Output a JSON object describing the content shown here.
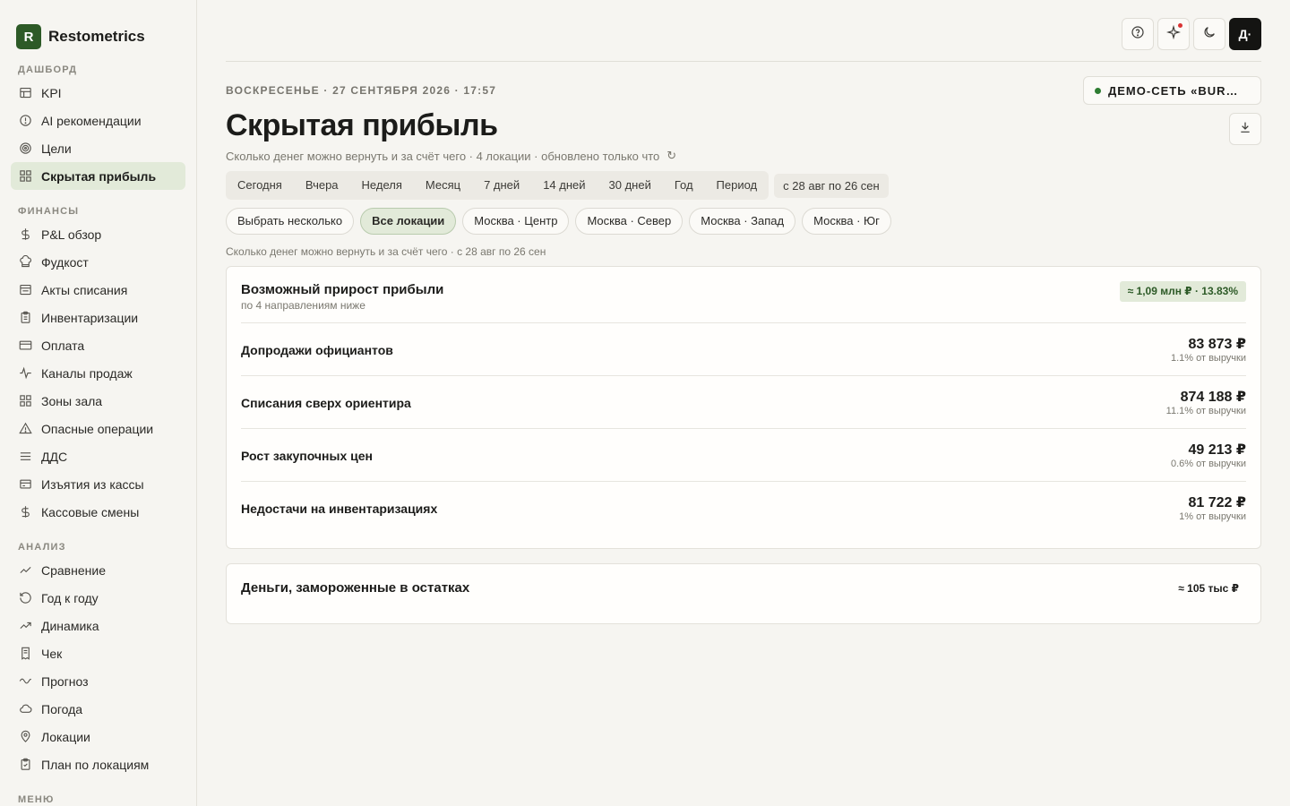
{
  "brand": {
    "logo_letter": "R",
    "name": "Restometrics"
  },
  "sidebar": {
    "sections": [
      {
        "label": "ДАШБОРД",
        "items": [
          {
            "label": "KPI",
            "icon": "table-icon"
          },
          {
            "label": "AI рекомендации",
            "icon": "alert-circle-icon"
          },
          {
            "label": "Цели",
            "icon": "target-icon"
          },
          {
            "label": "Скрытая прибыль",
            "icon": "grid-icon",
            "active": true
          }
        ]
      },
      {
        "label": "ФИНАНСЫ",
        "items": [
          {
            "label": "P&L обзор",
            "icon": "dollar-icon"
          },
          {
            "label": "Фудкост",
            "icon": "chef-hat-icon"
          },
          {
            "label": "Акты списания",
            "icon": "list-box-icon"
          },
          {
            "label": "Инвентаризации",
            "icon": "clipboard-icon"
          },
          {
            "label": "Оплата",
            "icon": "credit-card-icon"
          },
          {
            "label": "Каналы продаж",
            "icon": "activity-icon"
          },
          {
            "label": "Зоны зала",
            "icon": "grid-icon"
          },
          {
            "label": "Опасные операции",
            "icon": "warning-icon"
          },
          {
            "label": "ДДС",
            "icon": "menu-lines-icon"
          },
          {
            "label": "Изъятия из кассы",
            "icon": "cash-icon"
          },
          {
            "label": "Кассовые смены",
            "icon": "dollar-icon"
          }
        ]
      },
      {
        "label": "АНАЛИЗ",
        "items": [
          {
            "label": "Сравнение",
            "icon": "compare-icon"
          },
          {
            "label": "Год к году",
            "icon": "history-icon"
          },
          {
            "label": "Динамика",
            "icon": "trend-up-icon"
          },
          {
            "label": "Чек",
            "icon": "receipt-icon"
          },
          {
            "label": "Прогноз",
            "icon": "wave-icon"
          },
          {
            "label": "Погода",
            "icon": "cloud-icon"
          },
          {
            "label": "Локации",
            "icon": "map-pin-icon"
          },
          {
            "label": "План по локациям",
            "icon": "clipboard-check-icon"
          }
        ]
      },
      {
        "label": "МЕНЮ",
        "items": []
      }
    ]
  },
  "topbar": {
    "avatar_label": "Д·"
  },
  "header": {
    "dateline": "ВОСКРЕСЕНЬЕ · 27 СЕНТЯБРЯ 2026 · 17:57",
    "org_chip": "ДЕМО-СЕТЬ «BUR…",
    "title": "Скрытая прибыль",
    "subtitle": "Сколько денег можно вернуть и за счёт чего · 4 локации · обновлено только что",
    "refresh_glyph": "↻"
  },
  "periods": [
    "Сегодня",
    "Вчера",
    "Неделя",
    "Месяц",
    "7 дней",
    "14 дней",
    "30 дней",
    "Год",
    "Период"
  ],
  "period_range": "с 28 авг по 26 сен",
  "locations": {
    "multi_select": "Выбрать несколько",
    "items": [
      {
        "label": "Все локации",
        "active": true
      },
      {
        "label": "Москва · Центр"
      },
      {
        "label": "Москва · Север"
      },
      {
        "label": "Москва · Запад"
      },
      {
        "label": "Москва · Юг"
      }
    ]
  },
  "caption": "Сколько денег можно вернуть и за счёт чего · с 28 авг по 26 сен",
  "profit_card": {
    "title": "Возможный прирост прибыли",
    "subtitle": "по 4 направлениям ниже",
    "badge": "≈ 1,09 млн ₽ · 13.83%",
    "rows": [
      {
        "label": "Допродажи официантов",
        "value": "83 873 ₽",
        "share": "1.1% от выручки"
      },
      {
        "label": "Списания сверх ориентира",
        "value": "874 188 ₽",
        "share": "11.1% от выручки"
      },
      {
        "label": "Рост закупочных цен",
        "value": "49 213 ₽",
        "share": "0.6% от выручки"
      },
      {
        "label": "Недостачи на инвентаризациях",
        "value": "81 722 ₽",
        "share": "1% от выручки"
      }
    ]
  },
  "frozen_card": {
    "title": "Деньги, замороженные в остатках",
    "value": "≈ 105 тыс ₽"
  }
}
